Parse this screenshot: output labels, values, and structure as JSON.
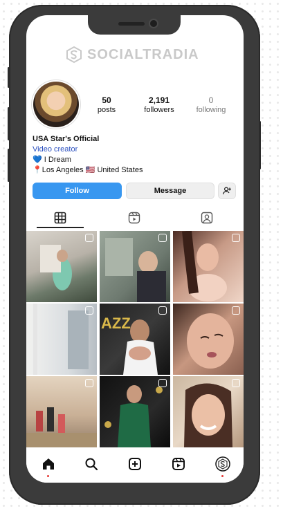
{
  "watermark": {
    "text": "SOCIALTRADIA"
  },
  "profile": {
    "stats": [
      {
        "value": "50",
        "label": "posts"
      },
      {
        "value": "2,191",
        "label": "followers"
      },
      {
        "value": "0",
        "label": "following"
      }
    ],
    "name": "USA Star's Official",
    "category": "Video creator",
    "bio_line1": "💙 I Dream",
    "bio_line2": "📍Los Angeles 🇺🇸 United States"
  },
  "actions": {
    "follow_label": "Follow",
    "message_label": "Message"
  },
  "tabs": [
    {
      "icon": "grid-icon"
    },
    {
      "icon": "reels-icon"
    },
    {
      "icon": "tagged-icon"
    }
  ],
  "grid_posts_count": 9,
  "bottom_nav": [
    {
      "icon": "home-icon"
    },
    {
      "icon": "search-icon"
    },
    {
      "icon": "create-icon"
    },
    {
      "icon": "reels-icon"
    },
    {
      "icon": "profile-icon"
    }
  ],
  "colors": {
    "follow_blue": "#3897f0",
    "phone_frame": "#3b3b3b",
    "category_link": "#2a4fbf",
    "nav_dot": "#e53935"
  }
}
